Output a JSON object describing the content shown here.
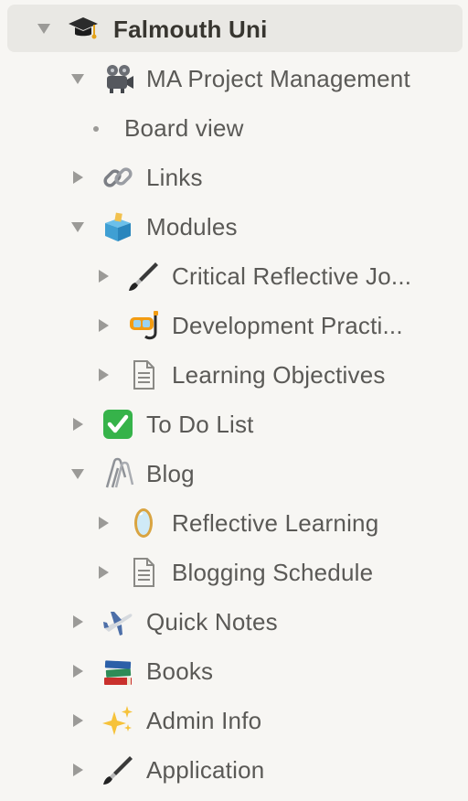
{
  "colors": {
    "background": "#f7f6f3",
    "selected_row": "#e9e8e4",
    "text": "#5a5956",
    "text_strong": "#37352f",
    "toggle": "#9b9a97"
  },
  "tree": {
    "root": {
      "label": "Falmouth Uni",
      "icon": "graduation-cap-icon",
      "expanded": true
    },
    "items": [
      {
        "label": "MA Project Management",
        "icon": "film-projector-icon",
        "expanded": true
      },
      {
        "label": "Board view",
        "icon": "bullet"
      },
      {
        "label": "Links",
        "icon": "link-icon",
        "expanded": false
      },
      {
        "label": "Modules",
        "icon": "ballot-box-icon",
        "expanded": true
      },
      {
        "label": "Critical Reflective Jo...",
        "icon": "paintbrush-icon",
        "expanded": false
      },
      {
        "label": "Development Practi...",
        "icon": "diving-mask-icon",
        "expanded": false
      },
      {
        "label": "Learning Objectives",
        "icon": "page-icon",
        "expanded": false
      },
      {
        "label": "To Do List",
        "icon": "check-mark-button-icon",
        "expanded": false
      },
      {
        "label": "Blog",
        "icon": "paperclips-icon",
        "expanded": true
      },
      {
        "label": "Reflective Learning",
        "icon": "mirror-icon",
        "expanded": false
      },
      {
        "label": "Blogging Schedule",
        "icon": "page-icon",
        "expanded": false
      },
      {
        "label": "Quick Notes",
        "icon": "airplane-icon",
        "expanded": false
      },
      {
        "label": "Books",
        "icon": "books-icon",
        "expanded": false
      },
      {
        "label": "Admin Info",
        "icon": "sparkles-icon",
        "expanded": false
      },
      {
        "label": "Application",
        "icon": "paintbrush-icon",
        "expanded": false
      }
    ]
  }
}
